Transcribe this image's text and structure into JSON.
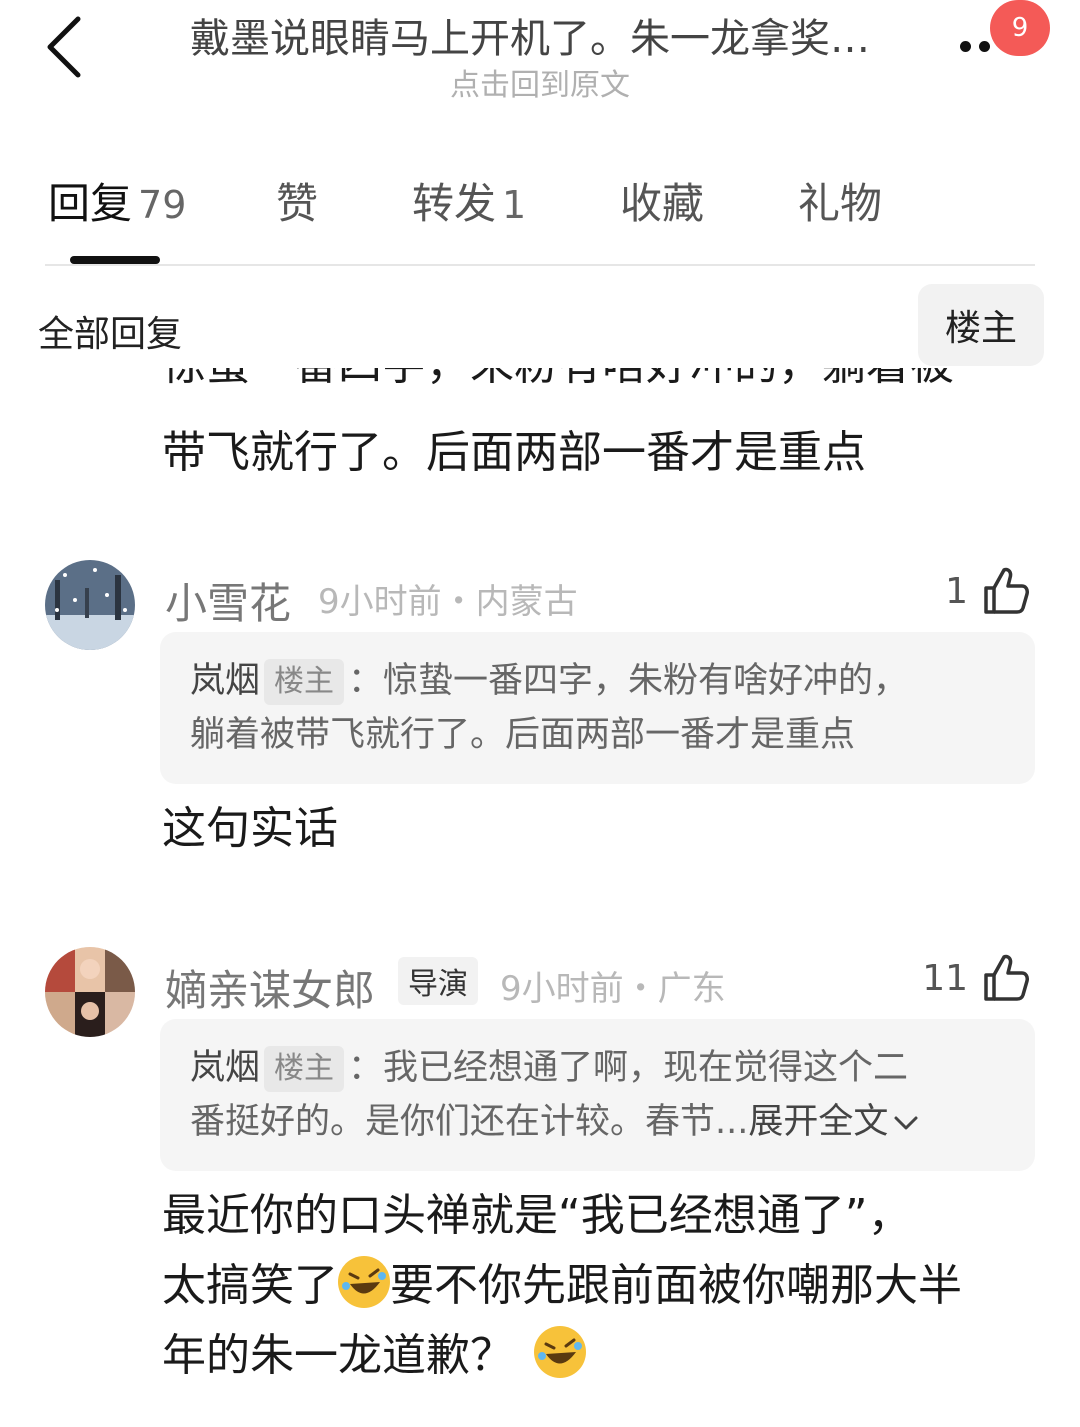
{
  "header": {
    "title": "戴墨说眼睛马上开机了。朱一龙拿奖…",
    "subtitle": "点击回到原文",
    "badge": "9"
  },
  "tabs": [
    {
      "label": "回复",
      "count": "79"
    },
    {
      "label": "赞",
      "count": ""
    },
    {
      "label": "转发",
      "count": "1"
    },
    {
      "label": "收藏",
      "count": ""
    },
    {
      "label": "礼物",
      "count": ""
    }
  ],
  "filter": {
    "label": "全部回复",
    "op_button": "楼主"
  },
  "previous_comment": {
    "line_clipped": "惊蛰一番四字，朱粉有啥好冲的，躺着被",
    "line_last": "带飞就行了。后面两部一番才是重点"
  },
  "comments": [
    {
      "name": "小雪花",
      "meta": "9小时前・内蒙古",
      "likes": "1",
      "quote": {
        "author": "岚烟",
        "op_tag": "楼主",
        "line1": "：惊蛰一番四字，朱粉有啥好冲的，",
        "line2": "躺着被带飞就行了。后面两部一番才是重点"
      },
      "text_lines": [
        "这句实话"
      ]
    },
    {
      "name": "嫡亲谋女郎",
      "tag": "导演",
      "meta": "9小时前・广东",
      "likes": "11",
      "quote": {
        "author": "岚烟",
        "op_tag": "楼主",
        "line1": "：我已经想通了啊，现在觉得这个二",
        "line2": "番挺好的。是你们还在计较。春节...",
        "expand": "展开全文"
      },
      "text_lines": [
        "最近你的口头禅就是“我已经想通了”，",
        "太搞笑了",
        "要不你先跟前面被你嘲那大半",
        "年的朱一龙道歉？"
      ]
    }
  ],
  "colors": {
    "badge": "#f45a57",
    "quote_bg": "#f5f5f5",
    "meta": "#b8b8b8"
  }
}
